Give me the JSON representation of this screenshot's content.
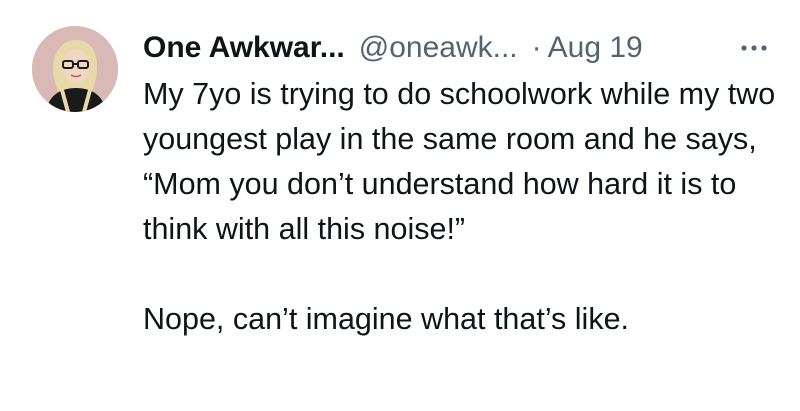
{
  "tweet": {
    "author": {
      "display_name": "One Awkwar...",
      "handle": "@oneawk...",
      "avatar_icon": "profile-avatar"
    },
    "separator": "·",
    "date": "Aug 19",
    "more_icon": "more-horizontal-icon",
    "text_paragraph_1": "My 7yo is trying to do schoolwork while my two youngest play in the same room and he says, “Mom you don’t understand how hard it is to think with all this noise!”",
    "text_paragraph_2": "Nope, can’t imagine what that’s like."
  },
  "colors": {
    "primary_text": "#0f1419",
    "secondary_text": "#536471",
    "avatar_bg": "#d9b9b6"
  }
}
